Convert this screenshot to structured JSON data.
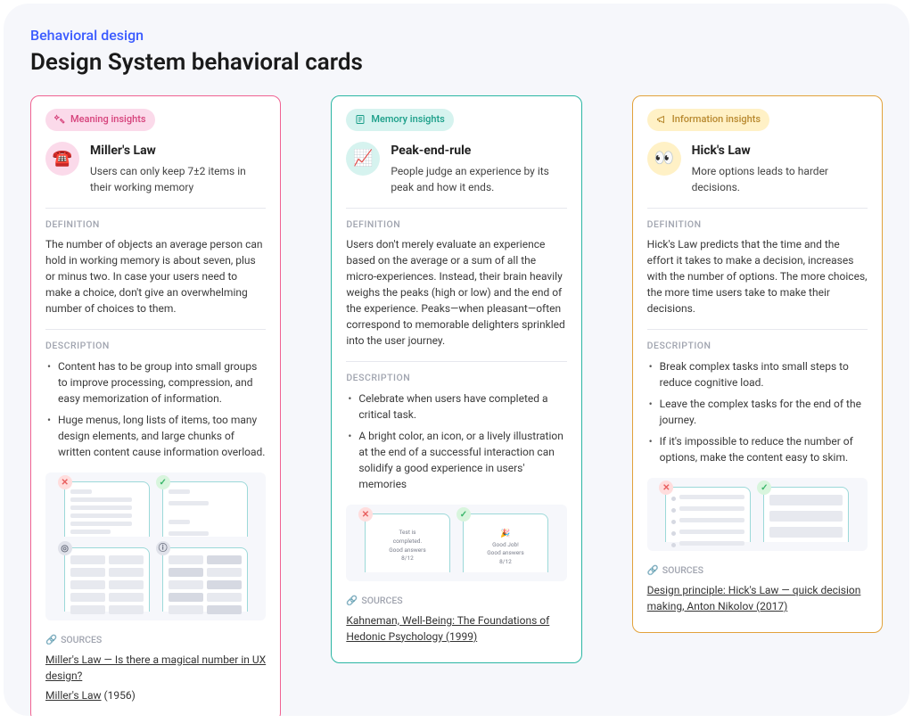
{
  "eyebrow": "Behavioral design",
  "title": "Design System behavioral cards",
  "labels": {
    "definition": "DEFINITION",
    "description": "DESCRIPTION",
    "sources": "SOURCES"
  },
  "cards": [
    {
      "badge": "Meaning insights",
      "law": "Miller's Law",
      "tagline": "Users can only keep 7±2 items in their working memory",
      "definition": "The number of objects an average person can hold in working memory is about seven, plus or minus two. In case your users need to make a choice, don't give an overwhelming number of choices to them.",
      "description": [
        "Content has to be group into small groups to improve processing, compression, and easy memorization of information.",
        "Huge menus, long lists of items, too many design elements, and large chunks of written content cause information overload."
      ],
      "sources": [
        {
          "text": "Miller's Law — Is there a magical number in UX design?",
          "link": true
        },
        {
          "text": "Miller's Law",
          "link": true,
          "suffix": " (1956)"
        }
      ]
    },
    {
      "badge": "Memory insights",
      "law": "Peak-end-rule",
      "tagline": "People judge an experience by its peak and how it ends.",
      "definition": "Users don't merely evaluate an experience based on the average or a sum of all the micro-experiences. Instead, their brain heavily weighs the peaks (high or low) and the end of the experience. Peaks—when pleasant—often correspond to memorable delighters sprinkled into the user journey.",
      "description": [
        "Celebrate when users have completed a critical task.",
        "A bright color, an icon, or a lively illustration at the end of a successful interaction can solidify a good experience in users' memories"
      ],
      "illus": {
        "bad": {
          "l1": "Test is",
          "l2": "completed.",
          "l3": "Good answers",
          "l4": "8/12"
        },
        "good": {
          "emoji": "🎉",
          "l1": "Good Job!",
          "l2": "Good answers",
          "l3": "8/12"
        }
      },
      "sources": [
        {
          "text": "Kahneman, Well-Being: The Foundations of Hedonic Psychology (1999)",
          "link": true
        }
      ]
    },
    {
      "badge": "Information insights",
      "law": "Hick's Law",
      "tagline": "More options leads to harder decisions.",
      "definition": "Hick's Law predicts that the time and the effort it takes to make a decision, increases with the number of options. The more choices, the more time users take to make their decisions.",
      "description": [
        "Break complex tasks into small steps to reduce cognitive load.",
        "Leave the complex tasks for the end of the journey.",
        "If it's impossible to reduce the number of options, make the content easy to skim."
      ],
      "sources": [
        {
          "text": "Design principle: Hick's Law — quick decision making, Anton Nikolov (2017)",
          "link": true
        }
      ]
    }
  ]
}
